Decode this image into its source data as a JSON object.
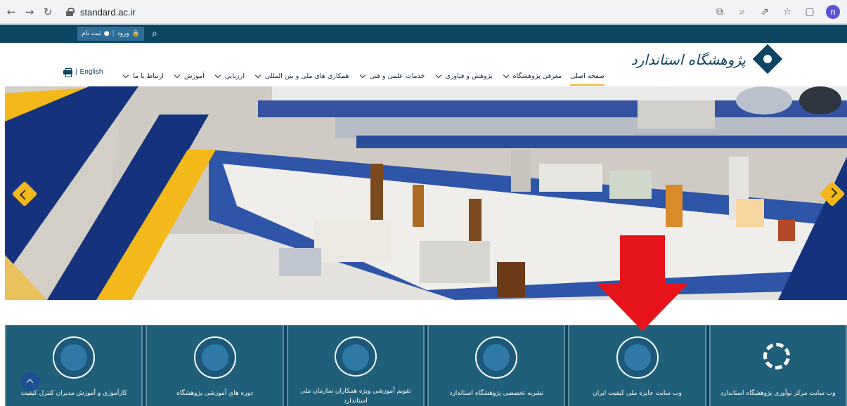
{
  "browser": {
    "url": "standard.ac.ir",
    "profile_initial": "n"
  },
  "topbar": {
    "login_label": "ورود",
    "register_label": "ثبت نام",
    "separator": "|"
  },
  "header": {
    "logo_text": "پژوهشگاه استاندارد",
    "lang_label": "English",
    "lang_separator": "|",
    "menu": [
      {
        "label": "صفحه اصلی",
        "active": true
      },
      {
        "label": "معرفی پژوهشگاه",
        "dropdown": true
      },
      {
        "label": "پژوهش و فناوری",
        "dropdown": true
      },
      {
        "label": "خدمات علمی و فنی",
        "dropdown": true
      },
      {
        "label": "همکاری های ملی و بین المللی",
        "dropdown": true
      },
      {
        "label": "ارزیابی",
        "dropdown": true
      },
      {
        "label": "آموزش",
        "dropdown": true
      },
      {
        "label": "ارتباط با ما",
        "dropdown": true
      }
    ]
  },
  "tiles": [
    {
      "label": "وب سایت مرکز نوآوری پژوهشگاه استاندارد",
      "icon": "innovation-gear-icon"
    },
    {
      "label": "وب سایت جایزه ملی کیفیت ایران",
      "icon": "quality-award-icon"
    },
    {
      "label": "نشریه تخصصی پژوهشگاه استاندارد",
      "icon": "journal-pen-icon"
    },
    {
      "label": "تقویم آموزشی ویژه همکاران سازمان ملی استاندارد",
      "icon": "training-board-icon"
    },
    {
      "label": "دوره های آموزشی پژوهشگاه",
      "icon": "customized-training-icon"
    },
    {
      "label": "کارآموزی و آموزش مدیران کنترل کیفیت",
      "icon": "internship-icon"
    }
  ],
  "colors": {
    "primary": "#0d4462",
    "tile_bg": "#1f5f79",
    "accent": "#f3b819",
    "annotation": "#e8141b"
  }
}
